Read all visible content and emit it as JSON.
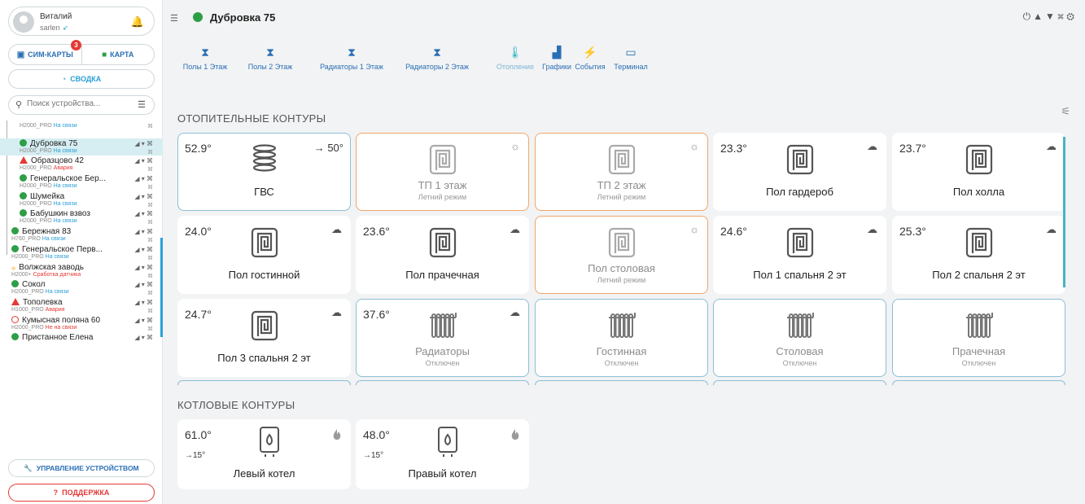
{
  "user": {
    "name": "Виталий",
    "login": "sarlen"
  },
  "nav": {
    "sim_label": "СИМ-КАРТЫ",
    "sim_badge": "3",
    "map_label": "КАРТА",
    "summary_label": "СВОДКА"
  },
  "search": {
    "placeholder": "Поиск устройства..."
  },
  "devices": [
    {
      "name": "",
      "status_model": "H2000_PRO",
      "status": "На связи",
      "status_kind": "ok",
      "mark": "none",
      "nested": true
    },
    {
      "name": "Дубровка 75",
      "status_model": "H2000_PRO",
      "status": "На связи",
      "status_kind": "ok",
      "mark": "green",
      "nested": true,
      "selected": true
    },
    {
      "name": "Образцово 42",
      "status_model": "H2000_PRO",
      "status": "Авария",
      "status_kind": "bad",
      "mark": "tri",
      "nested": true
    },
    {
      "name": "Генеральское Бер...",
      "status_model": "H2000_PRO",
      "status": "На связи",
      "status_kind": "ok",
      "mark": "green",
      "nested": true
    },
    {
      "name": "Шумейка",
      "status_model": "H2000_PRO",
      "status": "На связи",
      "status_kind": "ok",
      "mark": "green",
      "nested": true
    },
    {
      "name": "Бабушкин взвоз",
      "status_model": "H2000_PRO",
      "status": "На связи",
      "status_kind": "ok",
      "mark": "green",
      "nested": true
    },
    {
      "name": "Бережная 83",
      "status_model": "H760_PRO",
      "status": "На связи",
      "status_kind": "ok",
      "mark": "green",
      "nested": false
    },
    {
      "name": "Генеральское Перв...",
      "status_model": "H2000_PRO",
      "status": "На связи",
      "status_kind": "ok",
      "mark": "green",
      "nested": false
    },
    {
      "name": "Волжская заводь",
      "status_model": "H2000+",
      "status": "Сработка датчика",
      "status_kind": "warn",
      "mark": "ora",
      "nested": false
    },
    {
      "name": "Сокол",
      "status_model": "H2000_PRO",
      "status": "На связи",
      "status_kind": "ok",
      "mark": "green",
      "nested": false
    },
    {
      "name": "Тополевка",
      "status_model": "H1000_PRO",
      "status": "Авария",
      "status_kind": "bad",
      "mark": "tri",
      "nested": false
    },
    {
      "name": "Кумысная поляна 60",
      "status_model": "H2000_PRO",
      "status": "Не на связи",
      "status_kind": "bad",
      "mark": "ring",
      "nested": false
    },
    {
      "name": "Пристанное Елена",
      "status_model": "",
      "status": "",
      "status_kind": "ok",
      "mark": "green",
      "nested": false
    }
  ],
  "manage_label": "УПРАВЛЕНИЕ УСТРОЙСТВОМ",
  "support_label": "ПОДДЕРЖКА",
  "header": {
    "title": "Дубровка 75"
  },
  "tabs": [
    {
      "label": "Полы 1 Этаж"
    },
    {
      "label": "Полы 2 Этаж"
    },
    {
      "label": "Радиаторы 1 Этаж"
    },
    {
      "label": "Радиаторы 2 Этаж"
    },
    {
      "label": "Отопление",
      "active": true
    },
    {
      "label": "Графики"
    },
    {
      "label": "События"
    },
    {
      "label": "Терминал"
    }
  ],
  "sections": {
    "heating": "ОТОПИТЕЛЬНЫЕ КОНТУРЫ",
    "boiler": "КОТЛОВЫЕ КОНТУРЫ"
  },
  "cards": [
    {
      "temp": "52.9°",
      "setpoint": "→ 50°",
      "name": "ГВС",
      "icon": "coil-icon"
    },
    {
      "temp": "",
      "name": "ТП 1 этаж",
      "sub": "Летний режим",
      "icon": "floor-heating-icon",
      "weather": "sun"
    },
    {
      "temp": "",
      "name": "ТП 2 этаж",
      "sub": "Летний режим",
      "icon": "floor-heating-icon",
      "weather": "sun"
    },
    {
      "temp": "23.3°",
      "name": "Пол гардероб",
      "icon": "floor-heating-icon",
      "weather": "cloud"
    },
    {
      "temp": "23.7°",
      "name": "Пол холла",
      "icon": "floor-heating-icon",
      "weather": "cloud"
    },
    {
      "temp": "24.0°",
      "name": "Пол гостинной",
      "icon": "floor-heating-icon",
      "weather": "cloud"
    },
    {
      "temp": "23.6°",
      "name": "Пол прачечная",
      "icon": "floor-heating-icon",
      "weather": "cloud"
    },
    {
      "temp": "",
      "name": "Пол столовая",
      "sub": "Летний режим",
      "icon": "floor-heating-icon",
      "weather": "sun"
    },
    {
      "temp": "24.6°",
      "name": "Пол 1 спальня 2 эт",
      "icon": "floor-heating-icon",
      "weather": "cloud"
    },
    {
      "temp": "25.3°",
      "name": "Пол 2 спальня 2 эт",
      "icon": "floor-heating-icon",
      "weather": "cloud"
    },
    {
      "temp": "24.7°",
      "name": "Пол 3 спальня 2 эт",
      "icon": "floor-heating-icon",
      "weather": "cloud"
    },
    {
      "temp": "37.6°",
      "name": "Радиаторы",
      "sub": "Отключен",
      "icon": "radiator-icon",
      "weather": "cloud"
    },
    {
      "temp": "",
      "name": "Гостинная",
      "sub": "Отключен",
      "icon": "radiator-icon"
    },
    {
      "temp": "",
      "name": "Столовая",
      "sub": "Отключен",
      "icon": "radiator-icon"
    },
    {
      "temp": "",
      "name": "Прачечная",
      "sub": "Отключен",
      "icon": "radiator-icon"
    }
  ],
  "boilers": [
    {
      "temp": "61.0°",
      "outdoor": "→15°",
      "name": "Левый котел"
    },
    {
      "temp": "48.0°",
      "outdoor": "→15°",
      "name": "Правый котел"
    }
  ]
}
